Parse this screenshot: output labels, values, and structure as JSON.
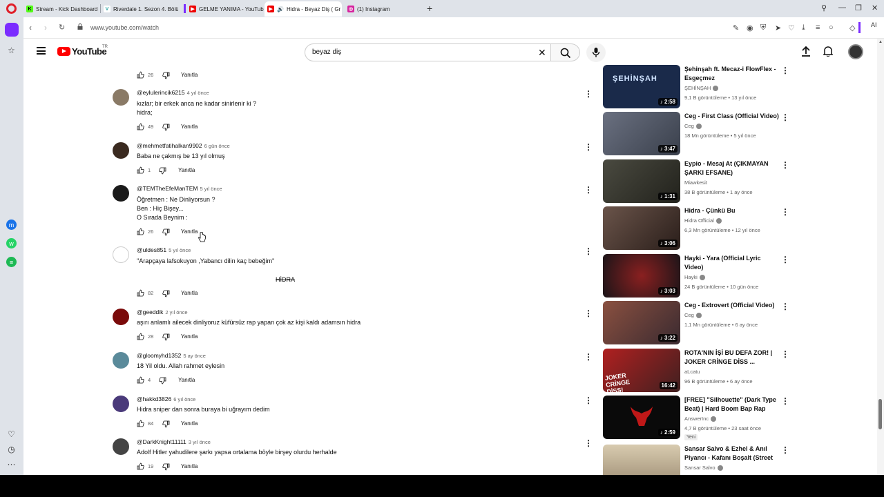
{
  "tabs": [
    {
      "title": "Stream - Kick Dashboard",
      "fav": "K",
      "color": "#53fc18"
    },
    {
      "title": "Riverdale 1. Sezon 4. Bölü",
      "fav": "V",
      "color": "#2aa3a3"
    },
    {
      "title": "GELME YANIMA - YouTub",
      "fav": "▶",
      "color": "#e00"
    },
    {
      "title": "Hidra - Beyaz Diş ( Gr",
      "fav": "▶",
      "color": "#e00"
    },
    {
      "title": "(1) Instagram",
      "fav": "◎",
      "color": "#d6249f"
    }
  ],
  "address": {
    "url": "www.youtube.com/watch",
    "ai_label": "AI"
  },
  "search": {
    "query": "beyaz diş",
    "logo_text": "YouTube",
    "region": "TR"
  },
  "reply_label": "Yanıtla",
  "comments": [
    {
      "author": "",
      "time": "",
      "lines": [],
      "likes": "26"
    },
    {
      "author": "@eylulerincik6215",
      "time": "4 yıl önce",
      "lines": [
        "kızlar; bir erkek anca ne kadar sinirlenir ki ?",
        "hidra;"
      ],
      "likes": "49"
    },
    {
      "author": "@mehmetfatihalkan9902",
      "time": "6 gün önce",
      "lines": [
        "Baba ne çakmış be 13 yıl olmuş"
      ],
      "likes": "1"
    },
    {
      "author": "@TEMTheEfeManTEM",
      "time": "5 yıl önce",
      "lines": [
        "Öğretmen : Ne Dinliyorsun ?",
        "Ben : Hiç Bişey...",
        "O Sırada Beynim :"
      ],
      "likes": "26"
    },
    {
      "author": "@uldes851",
      "time": "5 yıl önce",
      "lines": [
        "\"Arapçaya lafsokuyon ,Yabancı dilin kaç bebeğim\""
      ],
      "extra": "HİDRA",
      "likes": "82"
    },
    {
      "author": "@geeddik",
      "time": "2 yıl önce",
      "lines": [
        "aşırı anlamlı ailecek dinliyoruz küfürsüz rap yapan çok az kişi kaldı adamsın hidra"
      ],
      "likes": "28"
    },
    {
      "author": "@gloomyhd1352",
      "time": "5 ay önce",
      "lines": [
        "18 Yil oldu. Allah rahmet eylesin"
      ],
      "likes": "4"
    },
    {
      "author": "@hakkd3826",
      "time": "6 yıl önce",
      "lines": [
        "Hidra sniper dan sonra buraya bi uğrayım dedim"
      ],
      "likes": "84"
    },
    {
      "author": "@DarkKnight11111",
      "time": "3 yıl önce",
      "lines": [
        "Adolf Hitler yahudilere şarkı yapsa ortalama böyle birşey olurdu herhalde"
      ],
      "likes": "19"
    }
  ],
  "related": [
    {
      "title": "Şehinşah ft. Mecaz-i FlowFlex - Esgeçmez",
      "channel": "ŞEHİNŞAH",
      "verified": true,
      "meta": "9,1 B görüntüleme • 13 yıl önce",
      "duration": "2:58",
      "thumb_color": "#1a2a4a",
      "thumb_text": "ŞEHİNŞAH"
    },
    {
      "title": "Ceg - First Class (Official Video)",
      "channel": "Ceg",
      "verified": true,
      "meta": "18 Mn görüntüleme • 5 yıl önce",
      "duration": "3:47",
      "thumb_color": "#5a6070",
      "thumb_text": ""
    },
    {
      "title": "Eypio - Mesaj At (ÇIKMAYAN ŞARKI EFSANE)",
      "channel": "Miawkesit",
      "verified": false,
      "meta": "38 B görüntüleme • 1 ay önce",
      "duration": "1:31",
      "thumb_color": "#3a3a32",
      "thumb_text": ""
    },
    {
      "title": "Hidra - Çünkü Bu",
      "channel": "Hidra Official",
      "verified": true,
      "meta": "6,3 Mn görüntüleme • 12 yıl önce",
      "duration": "3:06",
      "thumb_color": "#4a3a36",
      "thumb_text": ""
    },
    {
      "title": "Hayki - Yara (Official Lyric Video)",
      "channel": "Hayki",
      "verified": true,
      "meta": "24 B görüntüleme • 10 gün önce",
      "duration": "3:03",
      "thumb_color": "#2a1e22",
      "thumb_text": ""
    },
    {
      "title": "Ceg - Extrovert (Official Video)",
      "channel": "Ceg",
      "verified": true,
      "meta": "1,1 Mn görüntüleme • 6 ay önce",
      "duration": "3:22",
      "thumb_color": "#6a3a30",
      "thumb_text": ""
    },
    {
      "title": "ROTA'NIN İŞİ BU DEFA ZOR! | JOKER CRİNGE DİSS ...",
      "channel": "aLcatu",
      "verified": false,
      "meta": "96 B görüntüleme • 6 ay önce",
      "duration": "16:42",
      "thumb_color": "#8a1a1a",
      "thumb_text": "JOKER CRİNGE DİSS!"
    },
    {
      "title": "[FREE] \"Silhouette\" (Dark Type Beat) | Hard Boom Bap Rap Be...",
      "channel": "AnswerInc",
      "verified": true,
      "meta": "4,7 B görüntüleme • 23 saat önce",
      "duration": "2:59",
      "thumb_color": "#0a0a0a",
      "thumb_text": "",
      "badge": "Yeni"
    },
    {
      "title": "Sansar Salvo & Ezhel & Anıl Piyancı - Kafanı Boşalt (Street ...",
      "channel": "Sansar Salvo",
      "verified": true,
      "meta": "",
      "duration": "",
      "thumb_color": "#c8b898",
      "thumb_text": ""
    }
  ]
}
